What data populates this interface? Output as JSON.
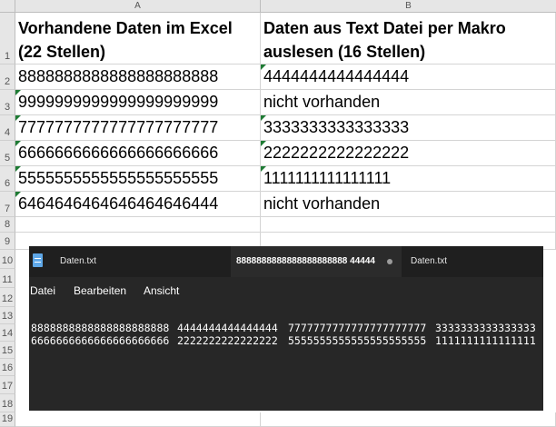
{
  "excel": {
    "columns": [
      "A",
      "B"
    ],
    "row_numbers": [
      "1",
      "2",
      "3",
      "4",
      "5",
      "6",
      "7",
      "8",
      "9",
      "10",
      "11",
      "12",
      "13",
      "14",
      "15",
      "16",
      "17",
      "18",
      "19"
    ],
    "header_a": "Vorhandene Daten im Excel (22 Stellen)",
    "header_b": "Daten aus Text Datei per Makro auslesen (16 Stellen)",
    "rows": [
      {
        "a": "8888888888888888888888",
        "b": "4444444444444444"
      },
      {
        "a": "9999999999999999999999",
        "b": "nicht vorhanden"
      },
      {
        "a": "7777777777777777777777",
        "b": "3333333333333333"
      },
      {
        "a": "6666666666666666666666",
        "b": "2222222222222222"
      },
      {
        "a": "5555555555555555555555",
        "b": "1111111111111111"
      },
      {
        "a": "6464646464646464646444",
        "b": "nicht vorhanden"
      }
    ],
    "indicator_color": "#1e7b34"
  },
  "notepad": {
    "tabs": [
      {
        "label": "Daten.txt"
      },
      {
        "label": "8888888888888888888888   44444"
      },
      {
        "label": "Daten.txt"
      }
    ],
    "menu": [
      "Datei",
      "Bearbeiten",
      "Ansicht"
    ],
    "lines": [
      [
        "8888888888888888888888",
        "4444444444444444",
        "7777777777777777777777",
        "3333333333333333"
      ],
      [
        "6666666666666666666666",
        "2222222222222222",
        "5555555555555555555555",
        "1111111111111111"
      ]
    ]
  }
}
